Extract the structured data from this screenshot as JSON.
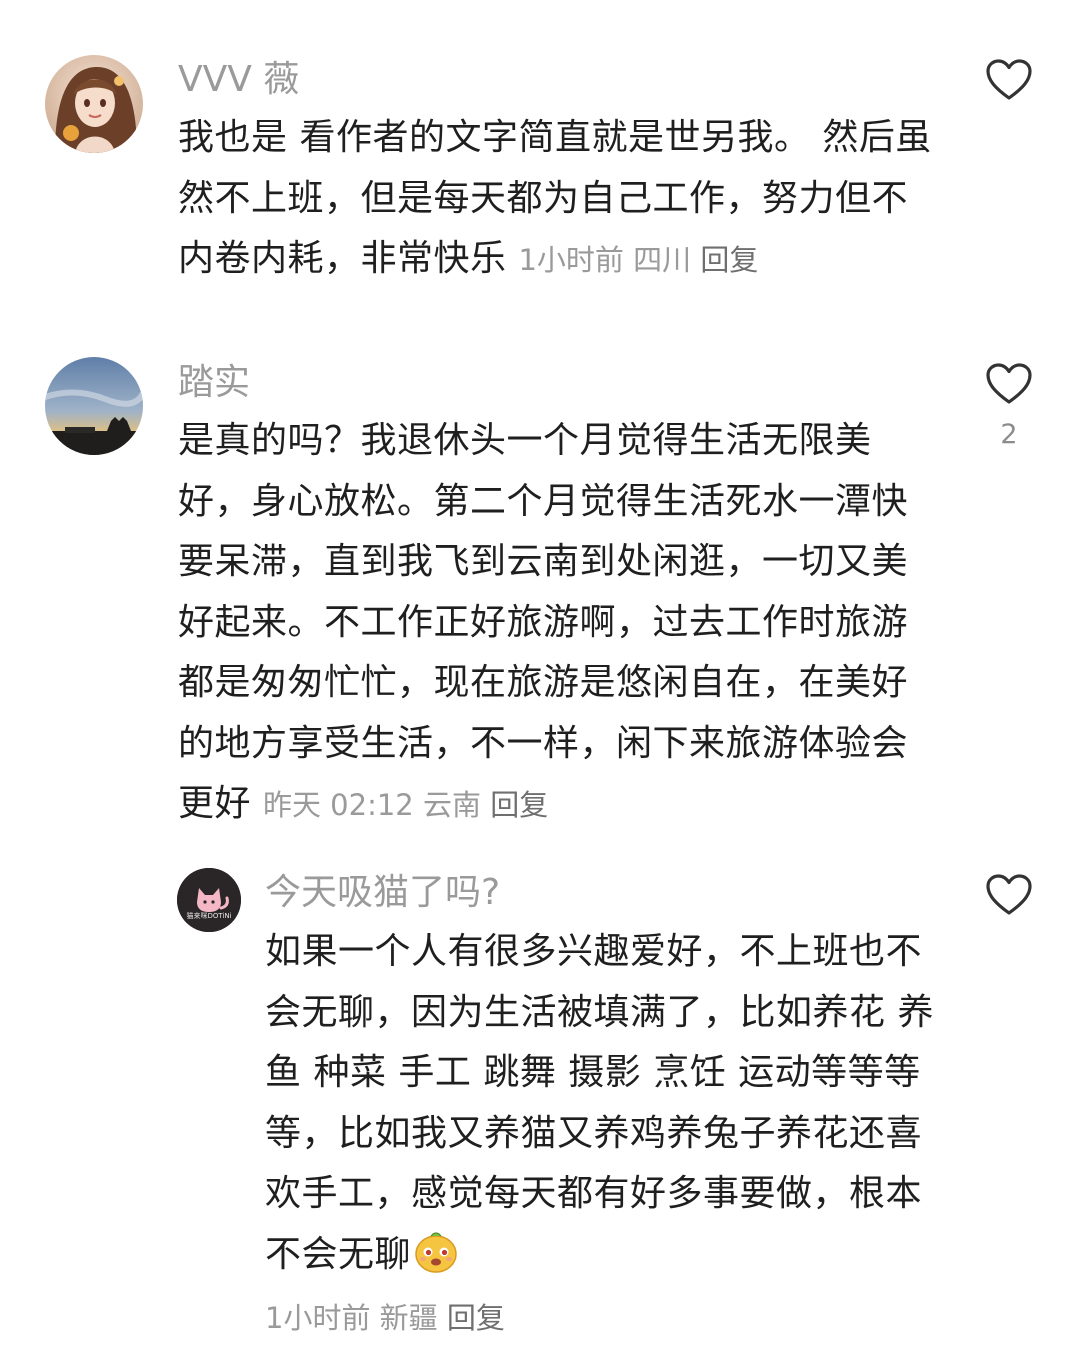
{
  "comments": [
    {
      "username": "VVV 薇",
      "avatar_icon": "anime-girl-avatar",
      "text": "我也是 看作者的文字简直就是世另我。 然后虽然不上班，但是每天都为自己工作，努力但不内卷内耗，非常快乐",
      "time": "1小时前",
      "location": "四川",
      "reply_label": "回复",
      "like_icon": "heart-outline-icon",
      "like_count": ""
    },
    {
      "username": "踏实",
      "avatar_icon": "sunset-landscape-avatar",
      "text": "是真的吗？我退休头一个月觉得生活无限美好，身心放松。第二个月觉得生活死水一潭快要呆滞，直到我飞到云南到处闲逛，一切又美好起来。不工作正好旅游啊，过去工作时旅游都是匆匆忙忙，现在旅游是悠闲自在，在美好的地方享受生活，不一样，闲下来旅游体验会更好",
      "time": "昨天 02:12",
      "location": "云南",
      "reply_label": "回复",
      "like_icon": "heart-outline-icon",
      "like_count": "2"
    },
    {
      "username": "今天吸猫了吗?",
      "avatar_icon": "cat-logo-avatar",
      "avatar_caption": "猫来咪DOTiNi",
      "text": "如果一个人有很多兴趣爱好，不上班也不会无聊，因为生活被填满了，比如养花 养鱼 种菜 手工 跳舞 摄影 烹饪  运动等等等等，比如我又养猫又养鸡养兔子养花还喜欢手工，感觉每天都有好多事要做，根本不会无聊",
      "emoji": "cute-face-emoji",
      "time": "1小时前",
      "location": "新疆",
      "reply_label": "回复",
      "like_icon": "heart-outline-icon",
      "like_count": ""
    }
  ],
  "colors": {
    "username": "#9a9a9a",
    "body": "#1f1f1f",
    "meta": "#9a9a9a",
    "reply": "#6f6f6f",
    "heart_stroke": "#333333"
  }
}
